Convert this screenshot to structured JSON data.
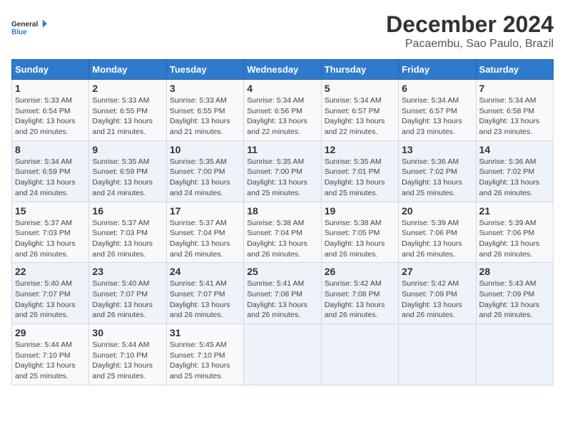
{
  "logo": {
    "line1": "General",
    "line2": "Blue"
  },
  "title": "December 2024",
  "subtitle": "Pacaembu, Sao Paulo, Brazil",
  "headers": [
    "Sunday",
    "Monday",
    "Tuesday",
    "Wednesday",
    "Thursday",
    "Friday",
    "Saturday"
  ],
  "weeks": [
    [
      {
        "day": "1",
        "sunrise": "Sunrise: 5:33 AM",
        "sunset": "Sunset: 6:54 PM",
        "daylight": "Daylight: 13 hours",
        "daylight2": "and 20 minutes."
      },
      {
        "day": "2",
        "sunrise": "Sunrise: 5:33 AM",
        "sunset": "Sunset: 6:55 PM",
        "daylight": "Daylight: 13 hours",
        "daylight2": "and 21 minutes."
      },
      {
        "day": "3",
        "sunrise": "Sunrise: 5:33 AM",
        "sunset": "Sunset: 6:55 PM",
        "daylight": "Daylight: 13 hours",
        "daylight2": "and 21 minutes."
      },
      {
        "day": "4",
        "sunrise": "Sunrise: 5:34 AM",
        "sunset": "Sunset: 6:56 PM",
        "daylight": "Daylight: 13 hours",
        "daylight2": "and 22 minutes."
      },
      {
        "day": "5",
        "sunrise": "Sunrise: 5:34 AM",
        "sunset": "Sunset: 6:57 PM",
        "daylight": "Daylight: 13 hours",
        "daylight2": "and 22 minutes."
      },
      {
        "day": "6",
        "sunrise": "Sunrise: 5:34 AM",
        "sunset": "Sunset: 6:57 PM",
        "daylight": "Daylight: 13 hours",
        "daylight2": "and 23 minutes."
      },
      {
        "day": "7",
        "sunrise": "Sunrise: 5:34 AM",
        "sunset": "Sunset: 6:58 PM",
        "daylight": "Daylight: 13 hours",
        "daylight2": "and 23 minutes."
      }
    ],
    [
      {
        "day": "8",
        "sunrise": "Sunrise: 5:34 AM",
        "sunset": "Sunset: 6:59 PM",
        "daylight": "Daylight: 13 hours",
        "daylight2": "and 24 minutes."
      },
      {
        "day": "9",
        "sunrise": "Sunrise: 5:35 AM",
        "sunset": "Sunset: 6:59 PM",
        "daylight": "Daylight: 13 hours",
        "daylight2": "and 24 minutes."
      },
      {
        "day": "10",
        "sunrise": "Sunrise: 5:35 AM",
        "sunset": "Sunset: 7:00 PM",
        "daylight": "Daylight: 13 hours",
        "daylight2": "and 24 minutes."
      },
      {
        "day": "11",
        "sunrise": "Sunrise: 5:35 AM",
        "sunset": "Sunset: 7:00 PM",
        "daylight": "Daylight: 13 hours",
        "daylight2": "and 25 minutes."
      },
      {
        "day": "12",
        "sunrise": "Sunrise: 5:35 AM",
        "sunset": "Sunset: 7:01 PM",
        "daylight": "Daylight: 13 hours",
        "daylight2": "and 25 minutes."
      },
      {
        "day": "13",
        "sunrise": "Sunrise: 5:36 AM",
        "sunset": "Sunset: 7:02 PM",
        "daylight": "Daylight: 13 hours",
        "daylight2": "and 25 minutes."
      },
      {
        "day": "14",
        "sunrise": "Sunrise: 5:36 AM",
        "sunset": "Sunset: 7:02 PM",
        "daylight": "Daylight: 13 hours",
        "daylight2": "and 26 minutes."
      }
    ],
    [
      {
        "day": "15",
        "sunrise": "Sunrise: 5:37 AM",
        "sunset": "Sunset: 7:03 PM",
        "daylight": "Daylight: 13 hours",
        "daylight2": "and 26 minutes."
      },
      {
        "day": "16",
        "sunrise": "Sunrise: 5:37 AM",
        "sunset": "Sunset: 7:03 PM",
        "daylight": "Daylight: 13 hours",
        "daylight2": "and 26 minutes."
      },
      {
        "day": "17",
        "sunrise": "Sunrise: 5:37 AM",
        "sunset": "Sunset: 7:04 PM",
        "daylight": "Daylight: 13 hours",
        "daylight2": "and 26 minutes."
      },
      {
        "day": "18",
        "sunrise": "Sunrise: 5:38 AM",
        "sunset": "Sunset: 7:04 PM",
        "daylight": "Daylight: 13 hours",
        "daylight2": "and 26 minutes."
      },
      {
        "day": "19",
        "sunrise": "Sunrise: 5:38 AM",
        "sunset": "Sunset: 7:05 PM",
        "daylight": "Daylight: 13 hours",
        "daylight2": "and 26 minutes."
      },
      {
        "day": "20",
        "sunrise": "Sunrise: 5:39 AM",
        "sunset": "Sunset: 7:06 PM",
        "daylight": "Daylight: 13 hours",
        "daylight2": "and 26 minutes."
      },
      {
        "day": "21",
        "sunrise": "Sunrise: 5:39 AM",
        "sunset": "Sunset: 7:06 PM",
        "daylight": "Daylight: 13 hours",
        "daylight2": "and 26 minutes."
      }
    ],
    [
      {
        "day": "22",
        "sunrise": "Sunrise: 5:40 AM",
        "sunset": "Sunset: 7:07 PM",
        "daylight": "Daylight: 13 hours",
        "daylight2": "and 26 minutes."
      },
      {
        "day": "23",
        "sunrise": "Sunrise: 5:40 AM",
        "sunset": "Sunset: 7:07 PM",
        "daylight": "Daylight: 13 hours",
        "daylight2": "and 26 minutes."
      },
      {
        "day": "24",
        "sunrise": "Sunrise: 5:41 AM",
        "sunset": "Sunset: 7:07 PM",
        "daylight": "Daylight: 13 hours",
        "daylight2": "and 26 minutes."
      },
      {
        "day": "25",
        "sunrise": "Sunrise: 5:41 AM",
        "sunset": "Sunset: 7:08 PM",
        "daylight": "Daylight: 13 hours",
        "daylight2": "and 26 minutes."
      },
      {
        "day": "26",
        "sunrise": "Sunrise: 5:42 AM",
        "sunset": "Sunset: 7:08 PM",
        "daylight": "Daylight: 13 hours",
        "daylight2": "and 26 minutes."
      },
      {
        "day": "27",
        "sunrise": "Sunrise: 5:42 AM",
        "sunset": "Sunset: 7:09 PM",
        "daylight": "Daylight: 13 hours",
        "daylight2": "and 26 minutes."
      },
      {
        "day": "28",
        "sunrise": "Sunrise: 5:43 AM",
        "sunset": "Sunset: 7:09 PM",
        "daylight": "Daylight: 13 hours",
        "daylight2": "and 26 minutes."
      }
    ],
    [
      {
        "day": "29",
        "sunrise": "Sunrise: 5:44 AM",
        "sunset": "Sunset: 7:10 PM",
        "daylight": "Daylight: 13 hours",
        "daylight2": "and 25 minutes."
      },
      {
        "day": "30",
        "sunrise": "Sunrise: 5:44 AM",
        "sunset": "Sunset: 7:10 PM",
        "daylight": "Daylight: 13 hours",
        "daylight2": "and 25 minutes."
      },
      {
        "day": "31",
        "sunrise": "Sunrise: 5:45 AM",
        "sunset": "Sunset: 7:10 PM",
        "daylight": "Daylight: 13 hours",
        "daylight2": "and 25 minutes."
      },
      null,
      null,
      null,
      null
    ]
  ]
}
